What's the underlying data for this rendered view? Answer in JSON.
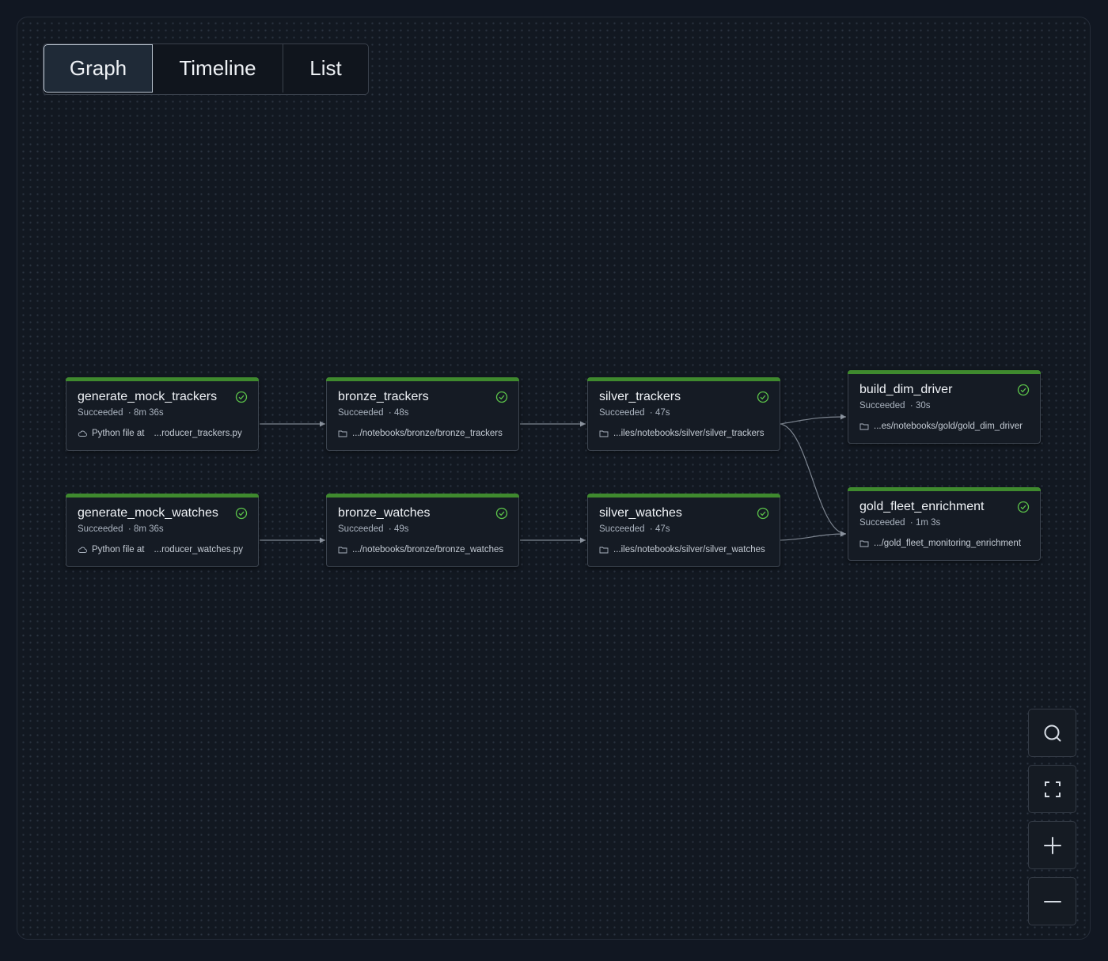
{
  "tabs": [
    {
      "label": "Graph",
      "active": true
    },
    {
      "label": "Timeline",
      "active": false
    },
    {
      "label": "List",
      "active": false
    }
  ],
  "colors": {
    "background": "#111722",
    "node_background": "#151b24",
    "success_bar": "#3f8a2e",
    "success_icon": "#5cc44a",
    "edge": "#7d8590"
  },
  "nodes": [
    {
      "title": "generate_mock_trackers",
      "status": "Succeeded",
      "duration": "8m 36s",
      "source_icon": "cloud-icon",
      "source_prefix": "Python file at",
      "path": "...roducer_trackers.py"
    },
    {
      "title": "bronze_trackers",
      "status": "Succeeded",
      "duration": "48s",
      "source_icon": "folder-icon",
      "path": ".../notebooks/bronze/bronze_trackers"
    },
    {
      "title": "silver_trackers",
      "status": "Succeeded",
      "duration": "47s",
      "source_icon": "folder-icon",
      "path": "...iles/notebooks/silver/silver_trackers"
    },
    {
      "title": "build_dim_driver",
      "status": "Succeeded",
      "duration": "30s",
      "source_icon": "folder-icon",
      "path": "...es/notebooks/gold/gold_dim_driver"
    },
    {
      "title": "generate_mock_watches",
      "status": "Succeeded",
      "duration": "8m 36s",
      "source_icon": "cloud-icon",
      "source_prefix": "Python file at",
      "path": "...roducer_watches.py"
    },
    {
      "title": "bronze_watches",
      "status": "Succeeded",
      "duration": "49s",
      "source_icon": "folder-icon",
      "path": ".../notebooks/bronze/bronze_watches"
    },
    {
      "title": "silver_watches",
      "status": "Succeeded",
      "duration": "47s",
      "source_icon": "folder-icon",
      "path": "...iles/notebooks/silver/silver_watches"
    },
    {
      "title": "gold_fleet_enrichment",
      "status": "Succeeded",
      "duration": "1m 3s",
      "source_icon": "folder-icon",
      "path": ".../gold_fleet_monitoring_enrichment"
    }
  ],
  "edges": [
    [
      "generate_mock_trackers",
      "bronze_trackers"
    ],
    [
      "bronze_trackers",
      "silver_trackers"
    ],
    [
      "silver_trackers",
      "build_dim_driver"
    ],
    [
      "silver_trackers",
      "gold_fleet_enrichment"
    ],
    [
      "generate_mock_watches",
      "bronze_watches"
    ],
    [
      "bronze_watches",
      "silver_watches"
    ],
    [
      "silver_watches",
      "gold_fleet_enrichment"
    ]
  ],
  "controls": [
    {
      "name": "search-button",
      "icon": "search-icon"
    },
    {
      "name": "fit-view-button",
      "icon": "fullscreen-icon"
    },
    {
      "name": "zoom-in-button",
      "icon": "plus-icon"
    },
    {
      "name": "zoom-out-button",
      "icon": "minus-icon"
    }
  ]
}
